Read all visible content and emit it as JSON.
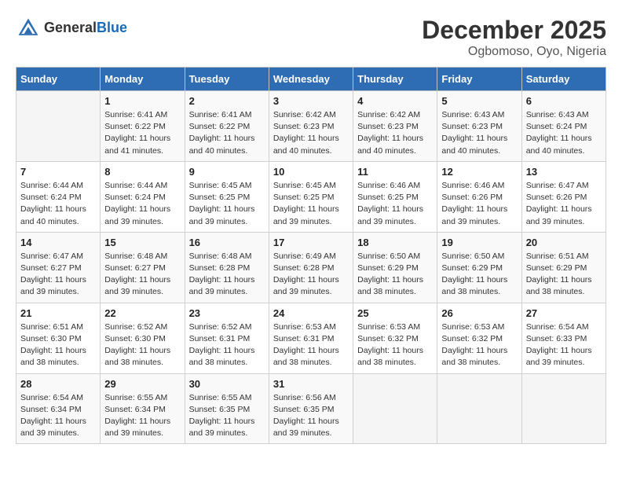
{
  "header": {
    "logo_general": "General",
    "logo_blue": "Blue",
    "month_year": "December 2025",
    "location": "Ogbomoso, Oyo, Nigeria"
  },
  "days_of_week": [
    "Sunday",
    "Monday",
    "Tuesday",
    "Wednesday",
    "Thursday",
    "Friday",
    "Saturday"
  ],
  "weeks": [
    [
      {
        "day": "",
        "sunrise": "",
        "sunset": "",
        "daylight": ""
      },
      {
        "day": "1",
        "sunrise": "Sunrise: 6:41 AM",
        "sunset": "Sunset: 6:22 PM",
        "daylight": "Daylight: 11 hours and 41 minutes."
      },
      {
        "day": "2",
        "sunrise": "Sunrise: 6:41 AM",
        "sunset": "Sunset: 6:22 PM",
        "daylight": "Daylight: 11 hours and 40 minutes."
      },
      {
        "day": "3",
        "sunrise": "Sunrise: 6:42 AM",
        "sunset": "Sunset: 6:23 PM",
        "daylight": "Daylight: 11 hours and 40 minutes."
      },
      {
        "day": "4",
        "sunrise": "Sunrise: 6:42 AM",
        "sunset": "Sunset: 6:23 PM",
        "daylight": "Daylight: 11 hours and 40 minutes."
      },
      {
        "day": "5",
        "sunrise": "Sunrise: 6:43 AM",
        "sunset": "Sunset: 6:23 PM",
        "daylight": "Daylight: 11 hours and 40 minutes."
      },
      {
        "day": "6",
        "sunrise": "Sunrise: 6:43 AM",
        "sunset": "Sunset: 6:24 PM",
        "daylight": "Daylight: 11 hours and 40 minutes."
      }
    ],
    [
      {
        "day": "7",
        "sunrise": "Sunrise: 6:44 AM",
        "sunset": "Sunset: 6:24 PM",
        "daylight": "Daylight: 11 hours and 40 minutes."
      },
      {
        "day": "8",
        "sunrise": "Sunrise: 6:44 AM",
        "sunset": "Sunset: 6:24 PM",
        "daylight": "Daylight: 11 hours and 39 minutes."
      },
      {
        "day": "9",
        "sunrise": "Sunrise: 6:45 AM",
        "sunset": "Sunset: 6:25 PM",
        "daylight": "Daylight: 11 hours and 39 minutes."
      },
      {
        "day": "10",
        "sunrise": "Sunrise: 6:45 AM",
        "sunset": "Sunset: 6:25 PM",
        "daylight": "Daylight: 11 hours and 39 minutes."
      },
      {
        "day": "11",
        "sunrise": "Sunrise: 6:46 AM",
        "sunset": "Sunset: 6:25 PM",
        "daylight": "Daylight: 11 hours and 39 minutes."
      },
      {
        "day": "12",
        "sunrise": "Sunrise: 6:46 AM",
        "sunset": "Sunset: 6:26 PM",
        "daylight": "Daylight: 11 hours and 39 minutes."
      },
      {
        "day": "13",
        "sunrise": "Sunrise: 6:47 AM",
        "sunset": "Sunset: 6:26 PM",
        "daylight": "Daylight: 11 hours and 39 minutes."
      }
    ],
    [
      {
        "day": "14",
        "sunrise": "Sunrise: 6:47 AM",
        "sunset": "Sunset: 6:27 PM",
        "daylight": "Daylight: 11 hours and 39 minutes."
      },
      {
        "day": "15",
        "sunrise": "Sunrise: 6:48 AM",
        "sunset": "Sunset: 6:27 PM",
        "daylight": "Daylight: 11 hours and 39 minutes."
      },
      {
        "day": "16",
        "sunrise": "Sunrise: 6:48 AM",
        "sunset": "Sunset: 6:28 PM",
        "daylight": "Daylight: 11 hours and 39 minutes."
      },
      {
        "day": "17",
        "sunrise": "Sunrise: 6:49 AM",
        "sunset": "Sunset: 6:28 PM",
        "daylight": "Daylight: 11 hours and 39 minutes."
      },
      {
        "day": "18",
        "sunrise": "Sunrise: 6:50 AM",
        "sunset": "Sunset: 6:29 PM",
        "daylight": "Daylight: 11 hours and 38 minutes."
      },
      {
        "day": "19",
        "sunrise": "Sunrise: 6:50 AM",
        "sunset": "Sunset: 6:29 PM",
        "daylight": "Daylight: 11 hours and 38 minutes."
      },
      {
        "day": "20",
        "sunrise": "Sunrise: 6:51 AM",
        "sunset": "Sunset: 6:29 PM",
        "daylight": "Daylight: 11 hours and 38 minutes."
      }
    ],
    [
      {
        "day": "21",
        "sunrise": "Sunrise: 6:51 AM",
        "sunset": "Sunset: 6:30 PM",
        "daylight": "Daylight: 11 hours and 38 minutes."
      },
      {
        "day": "22",
        "sunrise": "Sunrise: 6:52 AM",
        "sunset": "Sunset: 6:30 PM",
        "daylight": "Daylight: 11 hours and 38 minutes."
      },
      {
        "day": "23",
        "sunrise": "Sunrise: 6:52 AM",
        "sunset": "Sunset: 6:31 PM",
        "daylight": "Daylight: 11 hours and 38 minutes."
      },
      {
        "day": "24",
        "sunrise": "Sunrise: 6:53 AM",
        "sunset": "Sunset: 6:31 PM",
        "daylight": "Daylight: 11 hours and 38 minutes."
      },
      {
        "day": "25",
        "sunrise": "Sunrise: 6:53 AM",
        "sunset": "Sunset: 6:32 PM",
        "daylight": "Daylight: 11 hours and 38 minutes."
      },
      {
        "day": "26",
        "sunrise": "Sunrise: 6:53 AM",
        "sunset": "Sunset: 6:32 PM",
        "daylight": "Daylight: 11 hours and 38 minutes."
      },
      {
        "day": "27",
        "sunrise": "Sunrise: 6:54 AM",
        "sunset": "Sunset: 6:33 PM",
        "daylight": "Daylight: 11 hours and 39 minutes."
      }
    ],
    [
      {
        "day": "28",
        "sunrise": "Sunrise: 6:54 AM",
        "sunset": "Sunset: 6:34 PM",
        "daylight": "Daylight: 11 hours and 39 minutes."
      },
      {
        "day": "29",
        "sunrise": "Sunrise: 6:55 AM",
        "sunset": "Sunset: 6:34 PM",
        "daylight": "Daylight: 11 hours and 39 minutes."
      },
      {
        "day": "30",
        "sunrise": "Sunrise: 6:55 AM",
        "sunset": "Sunset: 6:35 PM",
        "daylight": "Daylight: 11 hours and 39 minutes."
      },
      {
        "day": "31",
        "sunrise": "Sunrise: 6:56 AM",
        "sunset": "Sunset: 6:35 PM",
        "daylight": "Daylight: 11 hours and 39 minutes."
      },
      {
        "day": "",
        "sunrise": "",
        "sunset": "",
        "daylight": ""
      },
      {
        "day": "",
        "sunrise": "",
        "sunset": "",
        "daylight": ""
      },
      {
        "day": "",
        "sunrise": "",
        "sunset": "",
        "daylight": ""
      }
    ]
  ]
}
